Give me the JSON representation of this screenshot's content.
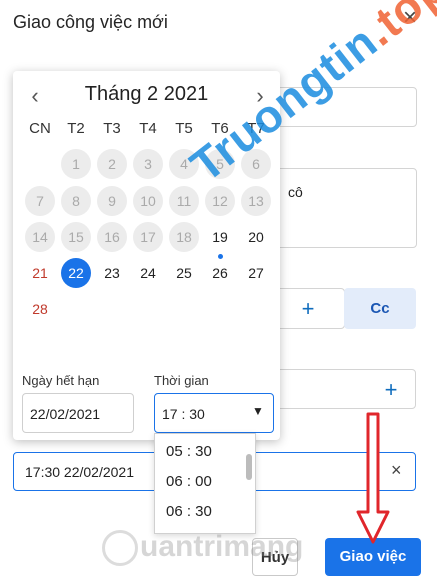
{
  "dialog": {
    "title": "Giao công việc mới",
    "close_icon": "×"
  },
  "form": {
    "description_snippet": "cô",
    "cc_label": "Cc",
    "due_value": "17:30 22/02/2021",
    "clear_icon": "×",
    "plus_icon": "+"
  },
  "calendar": {
    "prev_icon": "‹",
    "next_icon": "›",
    "month_label": "Tháng 2 2021",
    "weekdays": [
      "CN",
      "T2",
      "T3",
      "T4",
      "T5",
      "T6",
      "T7"
    ],
    "rows": [
      [
        {
          "d": "",
          "s": "blank"
        },
        {
          "d": "1",
          "s": "disabled"
        },
        {
          "d": "2",
          "s": "disabled"
        },
        {
          "d": "3",
          "s": "disabled"
        },
        {
          "d": "4",
          "s": "disabled"
        },
        {
          "d": "5",
          "s": "disabled"
        },
        {
          "d": "6",
          "s": "disabled"
        }
      ],
      [
        {
          "d": "7",
          "s": "disabled"
        },
        {
          "d": "8",
          "s": "disabled"
        },
        {
          "d": "9",
          "s": "disabled"
        },
        {
          "d": "10",
          "s": "disabled"
        },
        {
          "d": "11",
          "s": "disabled"
        },
        {
          "d": "12",
          "s": "disabled"
        },
        {
          "d": "13",
          "s": "disabled"
        }
      ],
      [
        {
          "d": "14",
          "s": "disabled"
        },
        {
          "d": "15",
          "s": "disabled"
        },
        {
          "d": "16",
          "s": "disabled"
        },
        {
          "d": "17",
          "s": "disabled"
        },
        {
          "d": "18",
          "s": "disabled"
        },
        {
          "d": "19",
          "s": "today"
        },
        {
          "d": "20",
          "s": "normal"
        }
      ],
      [
        {
          "d": "21",
          "s": "sunday"
        },
        {
          "d": "22",
          "s": "selected"
        },
        {
          "d": "23",
          "s": "normal"
        },
        {
          "d": "24",
          "s": "normal"
        },
        {
          "d": "25",
          "s": "normal"
        },
        {
          "d": "26",
          "s": "normal"
        },
        {
          "d": "27",
          "s": "normal"
        }
      ],
      [
        {
          "d": "28",
          "s": "sunday"
        }
      ]
    ],
    "due_date_label": "Ngày hết hạn",
    "due_date_value": "22/02/2021",
    "time_label": "Thời gian",
    "time_value": "17 : 30",
    "time_caret_icon": "▼",
    "time_options": [
      "05 : 30",
      "06 : 00",
      "06 : 30"
    ]
  },
  "footer": {
    "cancel_label": "Hủy",
    "submit_label": "Giao việc"
  },
  "watermark": {
    "top_main": "Truongtin",
    "top_accent": ".top",
    "bottom": "uantrimang"
  },
  "colors": {
    "accent": "#1a73e8",
    "sunday": "#c0392b",
    "arrow": "#e0262b"
  }
}
